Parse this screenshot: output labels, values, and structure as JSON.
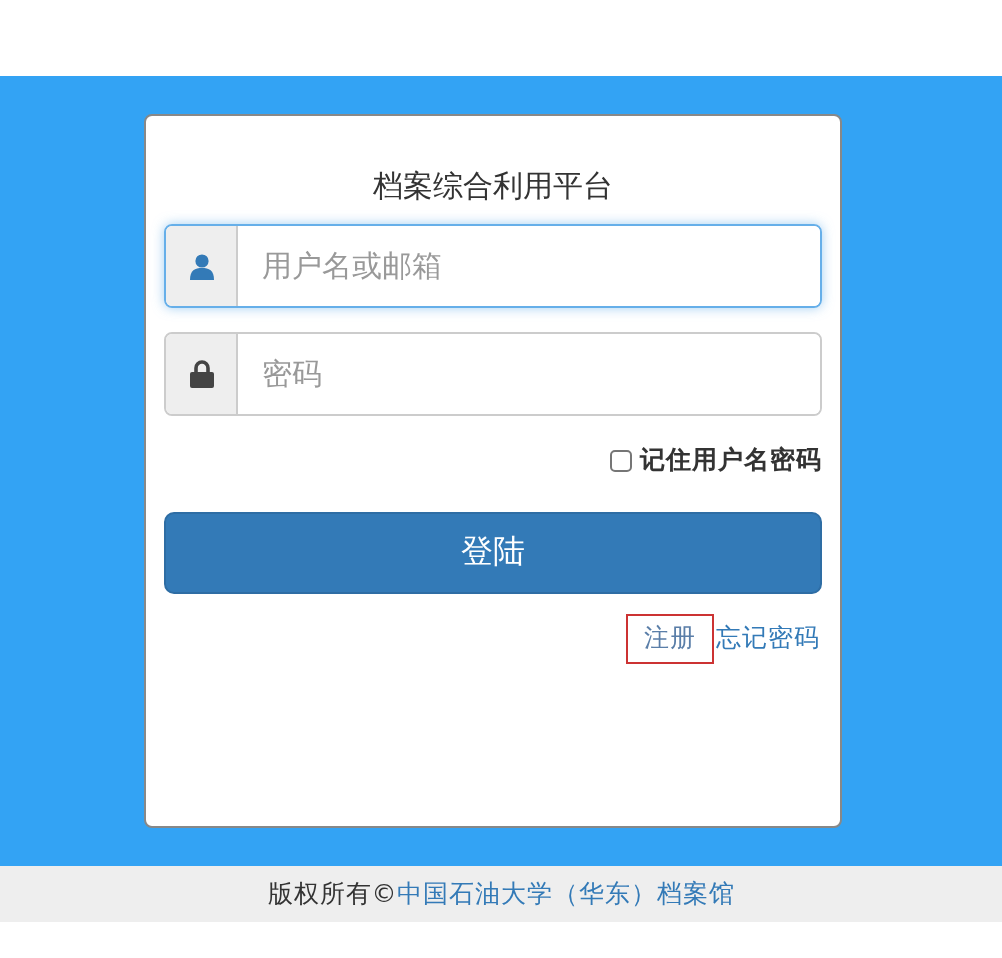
{
  "title": "档案综合利用平台",
  "fields": [
    {
      "kind": "user",
      "placeholder": "用户名或邮箱",
      "focused": true
    },
    {
      "kind": "lock",
      "placeholder": "密码",
      "focused": false
    }
  ],
  "remember": {
    "label": "记住用户名密码",
    "checked": false
  },
  "login_button": "登陆",
  "links": [
    {
      "label": "注册",
      "focused": true
    },
    {
      "label": "忘记密码",
      "focused": false
    }
  ],
  "footer": {
    "text": "版权所有©",
    "link": "中国石油大学（华东）档案馆"
  }
}
